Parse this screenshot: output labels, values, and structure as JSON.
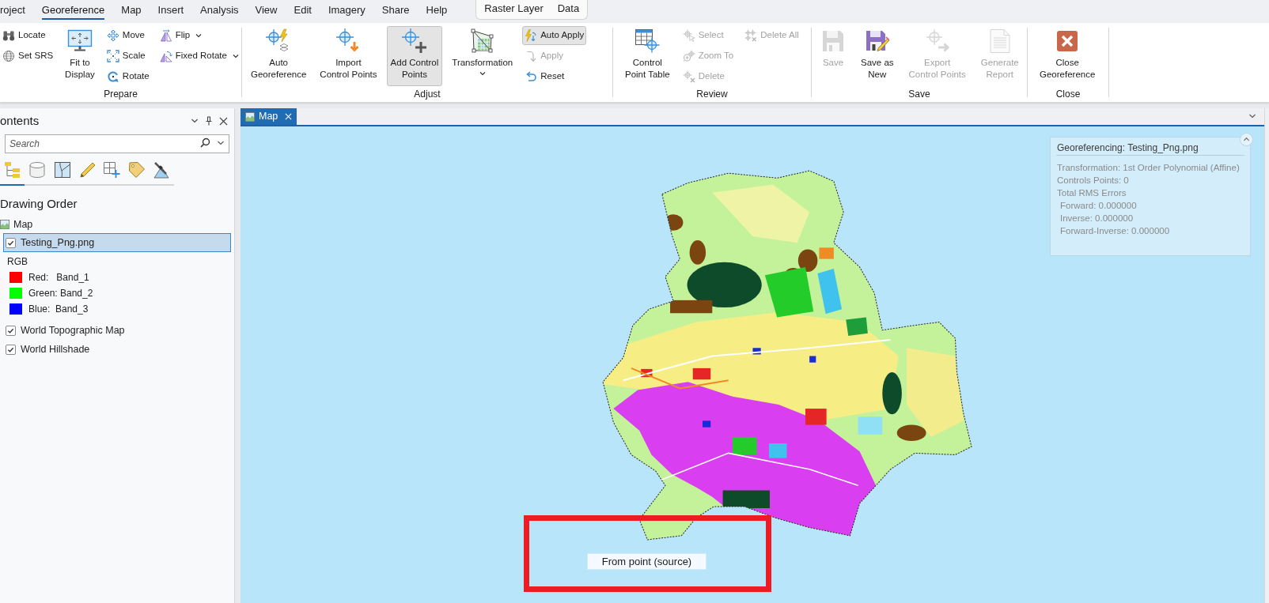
{
  "menu": {
    "tabs": [
      {
        "label": "roject",
        "selected": false
      },
      {
        "label": "Georeference",
        "selected": true
      },
      {
        "label": "Map",
        "selected": false
      },
      {
        "label": "Insert",
        "selected": false
      },
      {
        "label": "Analysis",
        "selected": false
      },
      {
        "label": "View",
        "selected": false
      },
      {
        "label": "Edit",
        "selected": false
      },
      {
        "label": "Imagery",
        "selected": false
      },
      {
        "label": "Share",
        "selected": false
      },
      {
        "label": "Help",
        "selected": false
      }
    ],
    "contextual_tabs": [
      {
        "label": "Raster Layer",
        "selected": false
      },
      {
        "label": "Data",
        "selected": false
      }
    ]
  },
  "ribbon": {
    "groups": [
      {
        "label": "Prepare",
        "columns": [
          {
            "kind": "stack",
            "items": [
              {
                "label": "Locate",
                "disabled": false,
                "pressed": false,
                "dropdown": false
              },
              {
                "label": "Set SRS",
                "disabled": false,
                "pressed": false,
                "dropdown": false
              }
            ]
          },
          {
            "kind": "large",
            "items": [
              {
                "label": "Fit to\nDisplay",
                "disabled": false,
                "pressed": false,
                "dropdown": false
              }
            ]
          },
          {
            "kind": "stack",
            "items": [
              {
                "label": "Move",
                "disabled": false,
                "pressed": false,
                "dropdown": false
              },
              {
                "label": "Scale",
                "disabled": false,
                "pressed": false,
                "dropdown": false
              },
              {
                "label": "Rotate",
                "disabled": false,
                "pressed": false,
                "dropdown": false
              }
            ]
          },
          {
            "kind": "stack",
            "items": [
              {
                "label": "Flip",
                "disabled": false,
                "pressed": false,
                "dropdown": true
              },
              {
                "label": "Fixed Rotate",
                "disabled": false,
                "pressed": false,
                "dropdown": true
              }
            ]
          }
        ]
      },
      {
        "label": "Adjust",
        "columns": [
          {
            "kind": "large",
            "items": [
              {
                "label": "Auto\nGeoreference",
                "disabled": false,
                "pressed": false,
                "dropdown": false
              }
            ]
          },
          {
            "kind": "large",
            "items": [
              {
                "label": "Import\nControl Points",
                "disabled": false,
                "pressed": false,
                "dropdown": false
              }
            ]
          },
          {
            "kind": "large",
            "items": [
              {
                "label": "Add Control\nPoints",
                "disabled": false,
                "pressed": true,
                "dropdown": false
              }
            ]
          },
          {
            "kind": "large",
            "items": [
              {
                "label": "Transformation",
                "disabled": false,
                "pressed": false,
                "dropdown": true
              }
            ]
          },
          {
            "kind": "stack",
            "items": [
              {
                "label": "Auto Apply",
                "disabled": false,
                "pressed": true,
                "dropdown": false
              },
              {
                "label": "Apply",
                "disabled": true,
                "pressed": false,
                "dropdown": false
              },
              {
                "label": "Reset",
                "disabled": false,
                "pressed": false,
                "dropdown": false
              }
            ]
          }
        ]
      },
      {
        "label": "Review",
        "columns": [
          {
            "kind": "large",
            "items": [
              {
                "label": "Control\nPoint Table",
                "disabled": false,
                "pressed": false,
                "dropdown": false
              }
            ]
          },
          {
            "kind": "stack",
            "items": [
              {
                "label": "Select",
                "disabled": true,
                "pressed": false,
                "dropdown": false
              },
              {
                "label": "Zoom To",
                "disabled": true,
                "pressed": false,
                "dropdown": false
              },
              {
                "label": "Delete",
                "disabled": true,
                "pressed": false,
                "dropdown": false
              }
            ]
          },
          {
            "kind": "stack",
            "items": [
              {
                "label": "Delete All",
                "disabled": true,
                "pressed": false,
                "dropdown": false
              }
            ]
          }
        ]
      },
      {
        "label": "Save",
        "columns": [
          {
            "kind": "large",
            "items": [
              {
                "label": "Save",
                "disabled": true,
                "pressed": false,
                "dropdown": false
              }
            ]
          },
          {
            "kind": "large",
            "items": [
              {
                "label": "Save as\nNew",
                "disabled": false,
                "pressed": false,
                "dropdown": false
              }
            ]
          },
          {
            "kind": "large",
            "items": [
              {
                "label": "Export\nControl Points",
                "disabled": true,
                "pressed": false,
                "dropdown": false
              }
            ]
          },
          {
            "kind": "large",
            "items": [
              {
                "label": "Generate\nReport",
                "disabled": true,
                "pressed": false,
                "dropdown": false
              }
            ]
          }
        ]
      },
      {
        "label": "Close",
        "columns": [
          {
            "kind": "large",
            "items": [
              {
                "label": "Close\nGeoreference",
                "disabled": false,
                "pressed": false,
                "dropdown": false
              }
            ]
          }
        ]
      }
    ]
  },
  "contents": {
    "title": "ontents",
    "search": {
      "placeholder": "Search"
    },
    "view_tabs": [
      {
        "selected": true
      },
      {
        "selected": false
      },
      {
        "selected": false
      },
      {
        "selected": false
      },
      {
        "selected": false
      },
      {
        "selected": false
      },
      {
        "selected": false
      }
    ],
    "heading": "Drawing Order",
    "tree": [
      {
        "kind": "map",
        "label": "Map",
        "children": [
          {
            "kind": "layer",
            "label": "Testing_Png.png",
            "checked": true,
            "selected": true,
            "children": [
              {
                "kind": "group",
                "label": "RGB"
              },
              {
                "kind": "band",
                "label": "Red:   Band_1",
                "color": "#ff0000"
              },
              {
                "kind": "band",
                "label": "Green: Band_2",
                "color": "#00ff00"
              },
              {
                "kind": "band",
                "label": "Blue:  Band_3",
                "color": "#0000ff"
              }
            ]
          },
          {
            "kind": "layer",
            "label": "World Topographic Map",
            "checked": true,
            "selected": false
          },
          {
            "kind": "layer",
            "label": "World Hillshade",
            "checked": true,
            "selected": false
          }
        ]
      }
    ]
  },
  "map_view": {
    "tabs": [
      {
        "label": "Map",
        "selected": true
      }
    ],
    "info_panel": {
      "title": "Georeferencing: Testing_Png.png",
      "expanded": true,
      "lines": [
        {
          "kind": "line",
          "text": "Transformation: 1st Order Polynomial (Affine)"
        },
        {
          "kind": "line",
          "text": "Controls Points: 0"
        },
        {
          "kind": "line",
          "text": "Total RMS Errors"
        },
        {
          "kind": "sub",
          "text": "Forward: 0.000000"
        },
        {
          "kind": "sub",
          "text": "Inverse: 0.000000"
        },
        {
          "kind": "sub",
          "text": "Forward-Inverse: 0.000000"
        }
      ]
    },
    "point_label": "From point (source)"
  }
}
